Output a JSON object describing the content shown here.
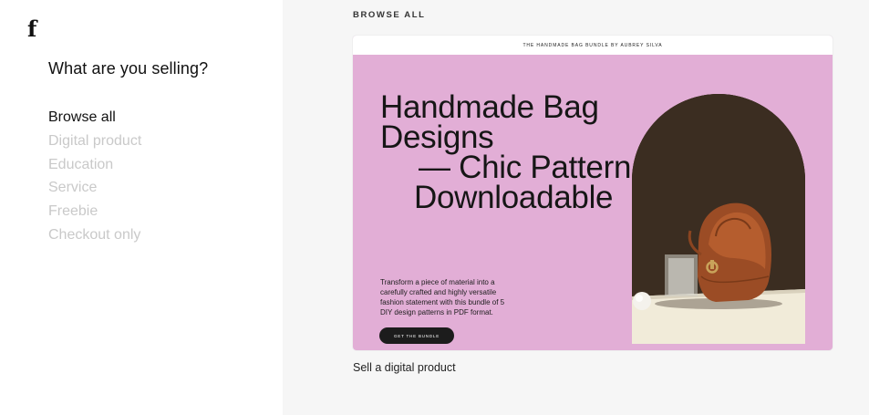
{
  "logo": {
    "text": "f"
  },
  "left": {
    "question": "What are you selling?",
    "categories": [
      {
        "label": "Browse all",
        "active": true
      },
      {
        "label": "Digital product",
        "active": false
      },
      {
        "label": "Education",
        "active": false
      },
      {
        "label": "Service",
        "active": false
      },
      {
        "label": "Freebie",
        "active": false
      },
      {
        "label": "Checkout only",
        "active": false
      }
    ]
  },
  "right": {
    "section_label": "BROWSE ALL",
    "template": {
      "header_text": "THE HANDMADE BAG BUNDLE BY AUBREY SILVA",
      "headline": [
        "Handmade Bag",
        "Designs",
        "— Chic Pattern",
        "Downloadable"
      ],
      "description": "Transform a piece of material into a carefully crafted and highly versatile fashion statement with this bundle of 5 DIY design patterns in PDF format.",
      "cta_label": "GET THE BUNDLE",
      "caption": "Sell a digital product",
      "image_name": "leather-bag-photo"
    },
    "colors": {
      "card_background": "#e2aed6",
      "arch_background": "#3d2f22",
      "cta_background": "#1c1c1c"
    }
  }
}
